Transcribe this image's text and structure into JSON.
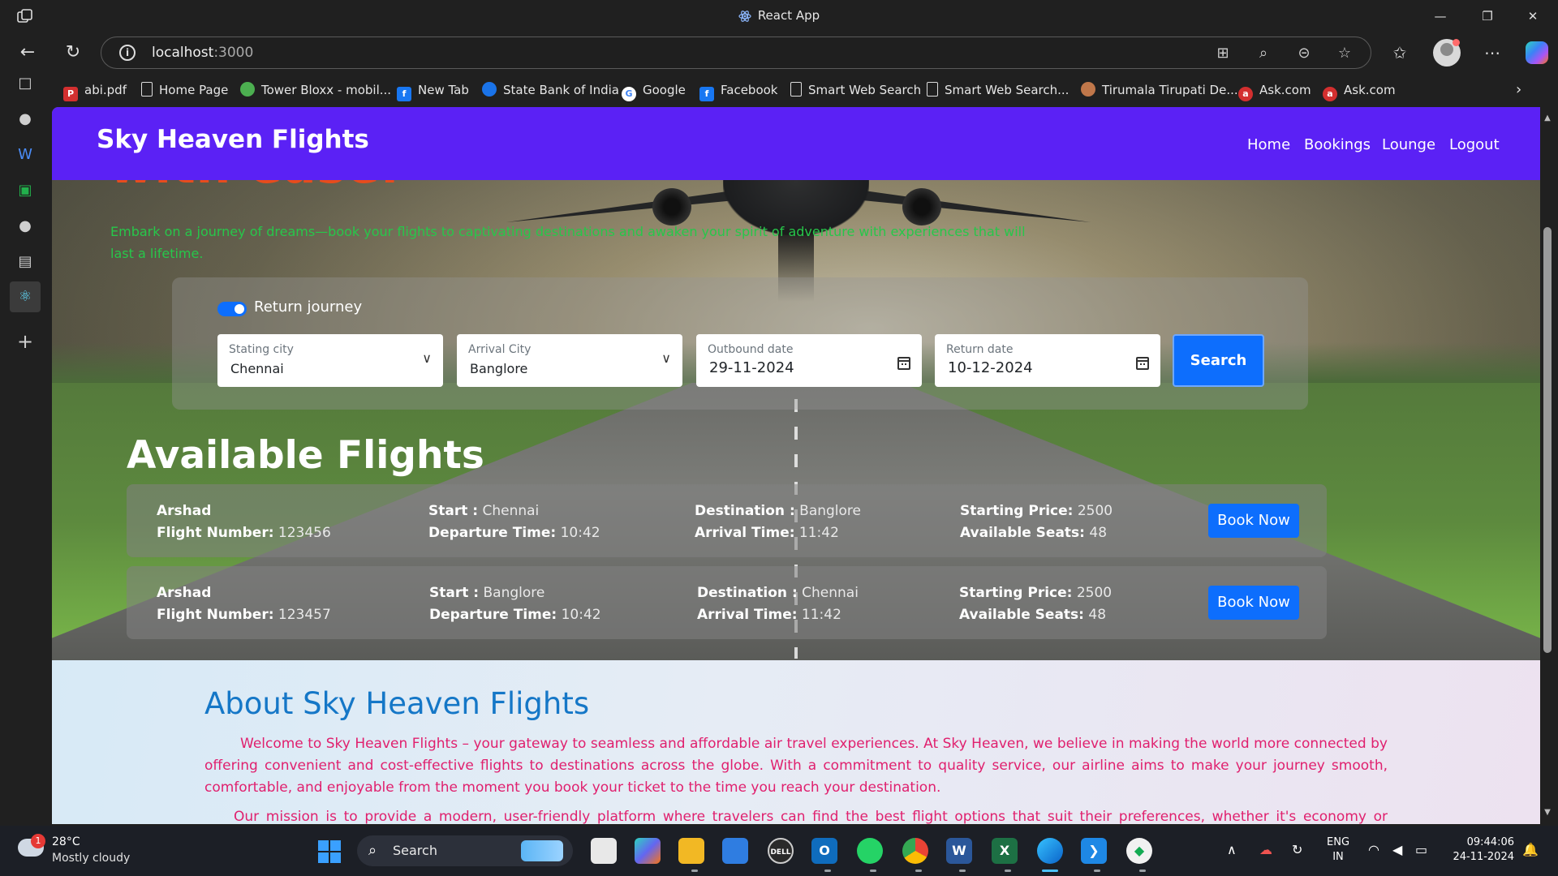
{
  "window": {
    "title": "React App"
  },
  "browser": {
    "url_host": "localhost",
    "url_port": ":3000"
  },
  "bookmarks": [
    {
      "label": "abi.pdf",
      "icon": "pdf-icon"
    },
    {
      "label": "Home Page",
      "icon": "page-icon"
    },
    {
      "label": "Tower Bloxx - mobil...",
      "icon": "tower-bloxx-icon"
    },
    {
      "label": "New Tab",
      "icon": "facebook-icon"
    },
    {
      "label": "State Bank of India",
      "icon": "sbi-icon"
    },
    {
      "label": "Google",
      "icon": "google-icon"
    },
    {
      "label": "Facebook",
      "icon": "facebook-icon"
    },
    {
      "label": "Smart Web Search",
      "icon": "page-icon"
    },
    {
      "label": "Smart Web Search...",
      "icon": "page-icon"
    },
    {
      "label": "Tirumala Tirupati De...",
      "icon": "ttd-icon"
    },
    {
      "label": "Ask.com",
      "icon": "ask-icon"
    },
    {
      "label": "Ask.com",
      "icon": "ask-icon"
    }
  ],
  "app": {
    "brand": "Sky Heaven Flights",
    "nav": [
      "Home",
      "Bookings",
      "Lounge",
      "Logout"
    ],
    "hero_heading": "with ease.",
    "hero_subtitle": "Embark on a journey of dreams—book your flights to captivating destinations and awaken your spirit of adventure with experiences that will last a lifetime."
  },
  "search": {
    "toggle_label": "Return journey",
    "toggle_on": true,
    "starting_city": {
      "label": "Stating city",
      "value": "Chennai"
    },
    "arrival_city": {
      "label": "Arrival City",
      "value": "Banglore"
    },
    "outbound_date": {
      "label": "Outbound date",
      "value": "29-11-2024"
    },
    "return_date": {
      "label": "Return date",
      "value": "10-12-2024"
    },
    "button": "Search"
  },
  "flights": {
    "title": "Available Flights",
    "labels": {
      "flight_number": "Flight Number:",
      "start": "Start :",
      "departure": "Departure Time:",
      "destination": "Destination :",
      "arrival": "Arrival Time:",
      "price": "Starting Price:",
      "seats": "Available Seats:",
      "book": "Book Now"
    },
    "items": [
      {
        "airline": "Arshad",
        "flight_number": "123456",
        "start": "Chennai",
        "departure": "10:42",
        "destination": "Banglore",
        "arrival": "11:42",
        "price": "2500",
        "seats": "48"
      },
      {
        "airline": "Arshad",
        "flight_number": "123457",
        "start": "Banglore",
        "departure": "10:42",
        "destination": "Chennai",
        "arrival": "11:42",
        "price": "2500",
        "seats": "48"
      }
    ]
  },
  "about": {
    "title": "About Sky Heaven Flights",
    "p1": "Welcome to Sky Heaven Flights – your gateway to seamless and affordable air travel experiences. At Sky Heaven, we believe in making the world more connected by offering convenient and cost-effective flights to destinations across the globe. With a commitment to quality service, our airline aims to make your journey smooth, comfortable, and enjoyable from the moment you book your ticket to the time you reach your destination.",
    "p2": "Our mission is to provide a modern, user-friendly platform where travelers can find the best flight options that suit their preferences, whether it's economy or business class, direct"
  },
  "taskbar": {
    "weather_badge": "1",
    "temperature": "28°C",
    "condition": "Mostly cloudy",
    "search": "Search",
    "lang1": "ENG",
    "lang2": "IN",
    "time": "09:44:06",
    "date": "24-11-2024"
  },
  "colors": {
    "header": "#5b21f5",
    "primary_button": "#0d6efd",
    "hero_heading": "#e74c1c",
    "hero_subtitle": "#27c74a",
    "about_title": "#1577c7",
    "about_text": "#e0206e"
  }
}
